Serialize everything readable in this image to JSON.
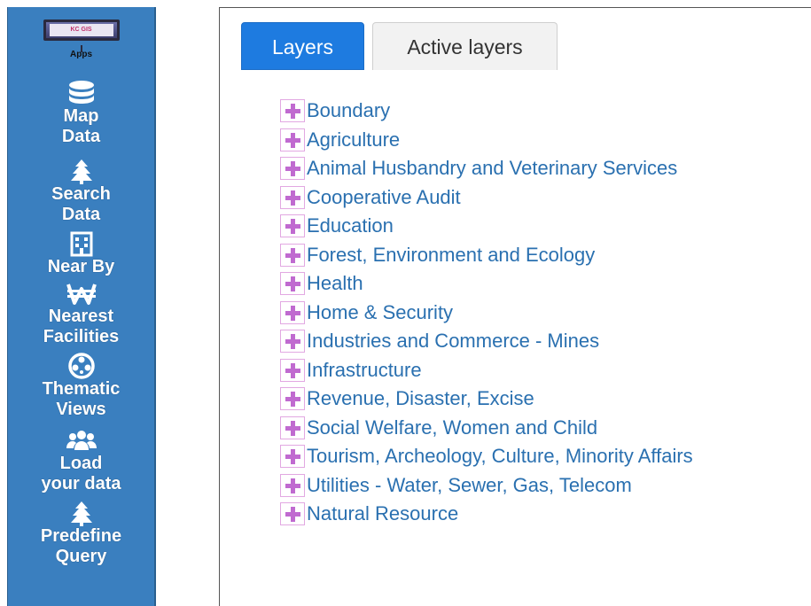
{
  "sidebar": {
    "apps_logo_text": "KC GIS",
    "apps_label": "Apps",
    "items": [
      {
        "label": "Map\nData",
        "icon": "database-icon"
      },
      {
        "label": "Search\nData",
        "icon": "tree-icon"
      },
      {
        "label": "Near By",
        "icon": "building-icon"
      },
      {
        "label": "Nearest\nFacilities",
        "icon": "won-sign-icon"
      },
      {
        "label": "Thematic\nViews",
        "icon": "film-reel-icon"
      },
      {
        "label": "Load\nyour data",
        "icon": "users-icon"
      },
      {
        "label": "Predefine\nQuery",
        "icon": "tree-icon"
      }
    ]
  },
  "tabs": {
    "layers": "Layers",
    "active_layers": "Active layers",
    "selected": "Layers"
  },
  "layers": [
    "Boundary",
    "Agriculture",
    " Animal Husbandry and Veterinary Services",
    "Cooperative Audit",
    "Education",
    " Forest, Environment and Ecology",
    "Health",
    "Home & Security",
    "Industries and Commerce - Mines",
    "Infrastructure",
    "Revenue, Disaster, Excise",
    "Social Welfare, Women and Child",
    " Tourism, Archeology, Culture, Minority Affairs",
    " Utilities - Water, Sewer, Gas, Telecom",
    "Natural Resource"
  ],
  "colors": {
    "sidebar_bg": "#3a7fbf",
    "tab_active_bg": "#1e7be0",
    "layer_text": "#2a70b0",
    "plus_icon": "#c06ad0"
  }
}
